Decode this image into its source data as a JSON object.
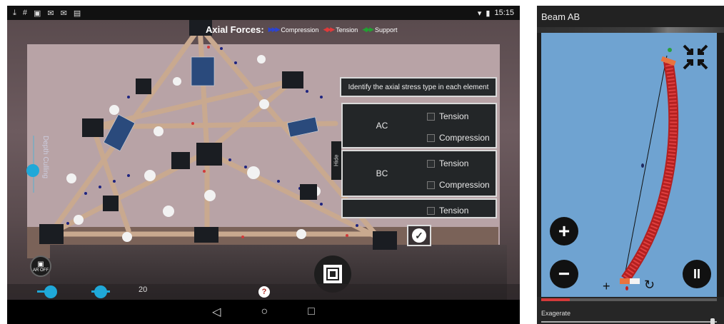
{
  "left_app": {
    "status_bar": {
      "icons": [
        "download-icon",
        "hash-icon",
        "gallery-icon",
        "mail-icon",
        "mail-icon",
        "briefcase-icon"
      ],
      "time": "15:15"
    },
    "legend": {
      "title": "Axial Forces:",
      "items": [
        {
          "label": "Compression",
          "color": "#2a43d4"
        },
        {
          "label": "Tension",
          "color": "#e03a3a"
        },
        {
          "label": "Support",
          "color": "#23a033"
        }
      ]
    },
    "depth_culling": {
      "label": "Depth Culling"
    },
    "question": {
      "prompt": "Identify the axial stress type in each element",
      "elements": [
        {
          "name": "AC",
          "options": [
            "Tension",
            "Compression"
          ]
        },
        {
          "name": "BC",
          "options": [
            "Tension",
            "Compression"
          ]
        },
        {
          "name": "",
          "options": [
            "Tension"
          ]
        }
      ],
      "hide_label": "Hide"
    },
    "ar_off_label": "AR OFF",
    "slider_value": "20",
    "help_label": "?",
    "nav": {
      "back": "◁",
      "home": "○",
      "recents": "□"
    }
  },
  "right_app": {
    "title": "Beam AB",
    "zoom_in_label": "+",
    "zoom_out_label": "−",
    "pause_label": "II",
    "exaggerate_label": "Exagerate",
    "colors": {
      "canvas": "#6fa3d1",
      "beam": "#d63a3a"
    }
  }
}
